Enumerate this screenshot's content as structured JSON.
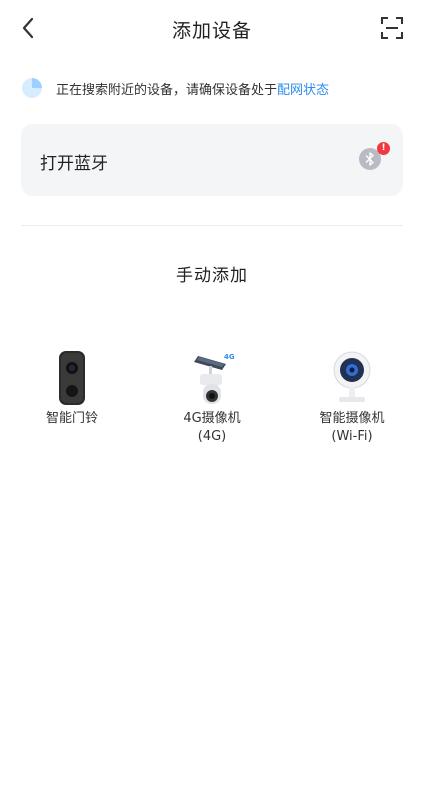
{
  "header": {
    "title": "添加设备",
    "back_icon": "chevron-left-icon",
    "scan_icon": "scan-frame-icon"
  },
  "search": {
    "text": "正在搜索附近的设备，请确保设备处于",
    "link": "配网状态",
    "link_color": "#2d8cf0"
  },
  "bluetooth": {
    "label": "打开蓝牙",
    "icon": "bluetooth-icon",
    "badge": "!"
  },
  "manual": {
    "title": "手动添加"
  },
  "devices": [
    {
      "name": "智能门铃",
      "name2": "",
      "icon": "doorbell-icon"
    },
    {
      "name": "4G摄像机",
      "name2": "(4G)",
      "icon": "solar-4g-camera-icon"
    },
    {
      "name": "智能摄像机",
      "name2": "(Wi-Fi)",
      "icon": "wifi-camera-icon"
    }
  ]
}
